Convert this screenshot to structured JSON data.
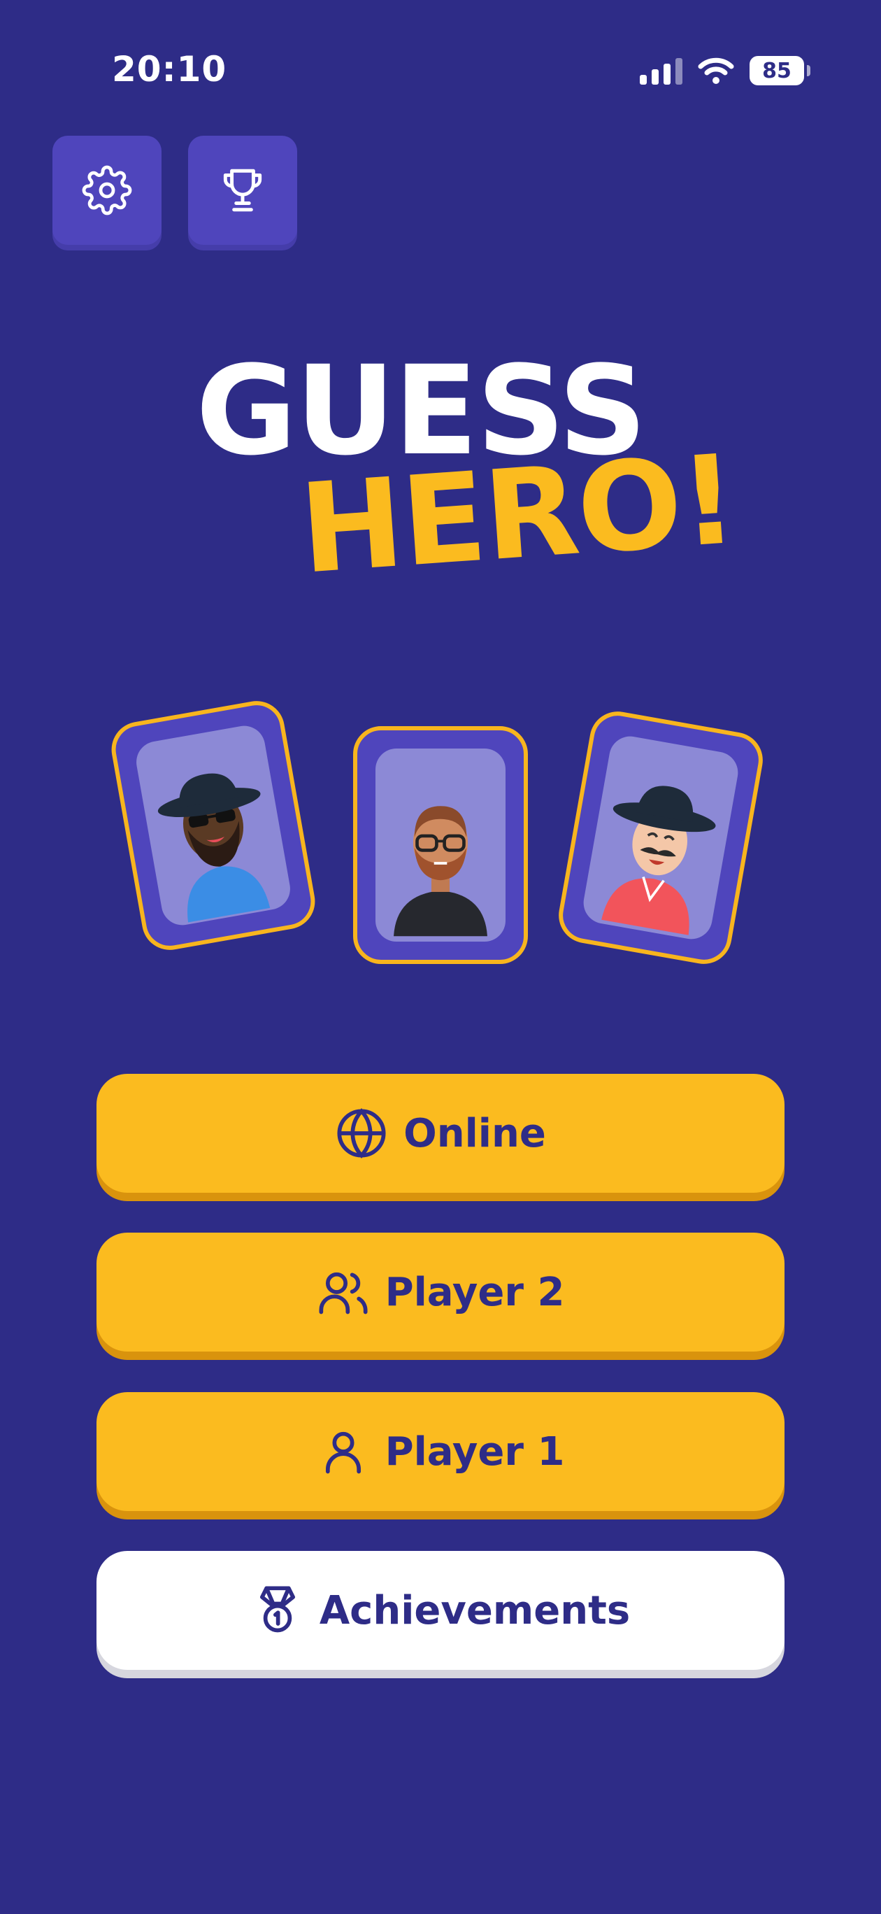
{
  "status_bar": {
    "time": "20:10",
    "battery": "85",
    "icons": [
      "signal-icon",
      "wifi-icon",
      "battery-icon"
    ]
  },
  "toolbar": {
    "icons": [
      "gear-icon",
      "trophy-icon"
    ]
  },
  "title": {
    "line1": "GUESS",
    "line2": "HERO!"
  },
  "cards": [
    "avatar-sunglasses-hat",
    "avatar-glasses-beard",
    "avatar-mustache-hat"
  ],
  "menu": {
    "online_label": "Online",
    "player2_label": "Player 2",
    "player1_label": "Player 1",
    "achievements_label": "Achievements"
  },
  "colors": {
    "background": "#2E2C87",
    "accent_yellow": "#FBBB1F",
    "button_purple": "#4F45BC",
    "text_dark": "#2E2C87"
  }
}
